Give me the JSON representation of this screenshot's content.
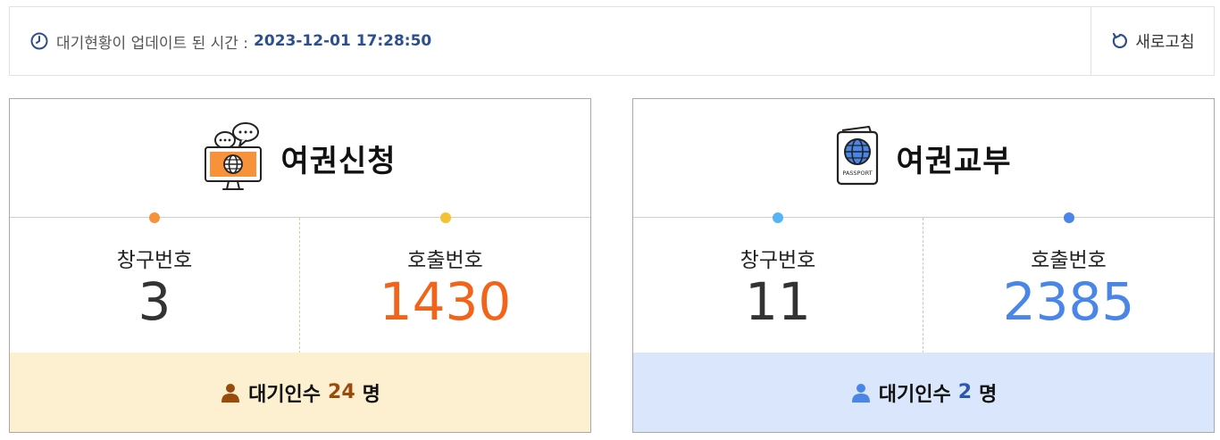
{
  "status": {
    "label": "대기현황이 업데이트 된 시간 :",
    "time": "2023-12-01 17:28:50",
    "icon": "clock-icon"
  },
  "refresh": {
    "label": "새로고침",
    "icon": "refresh-icon"
  },
  "cards": [
    {
      "title": "여권신청",
      "icon": "monitor-globe-chat-icon",
      "window_label": "창구번호",
      "window_number": "3",
      "call_label": "호출번호",
      "call_number": "1430",
      "waiting_label": "대기인수",
      "waiting_count": "24",
      "waiting_unit": "명",
      "colors": {
        "dot_left": "#f7923a",
        "dot_right": "#f6c033",
        "accent": "#f26419",
        "footer_bg": "#fdf0d1"
      }
    },
    {
      "title": "여권교부",
      "icon": "passport-icon",
      "icon_text": "PASSPORT",
      "window_label": "창구번호",
      "window_number": "11",
      "call_label": "호출번호",
      "call_number": "2385",
      "waiting_label": "대기인수",
      "waiting_count": "2",
      "waiting_unit": "명",
      "colors": {
        "dot_left": "#55b4f5",
        "dot_right": "#4a86e8",
        "accent": "#4a86e8",
        "footer_bg": "#dae6fb"
      }
    }
  ]
}
